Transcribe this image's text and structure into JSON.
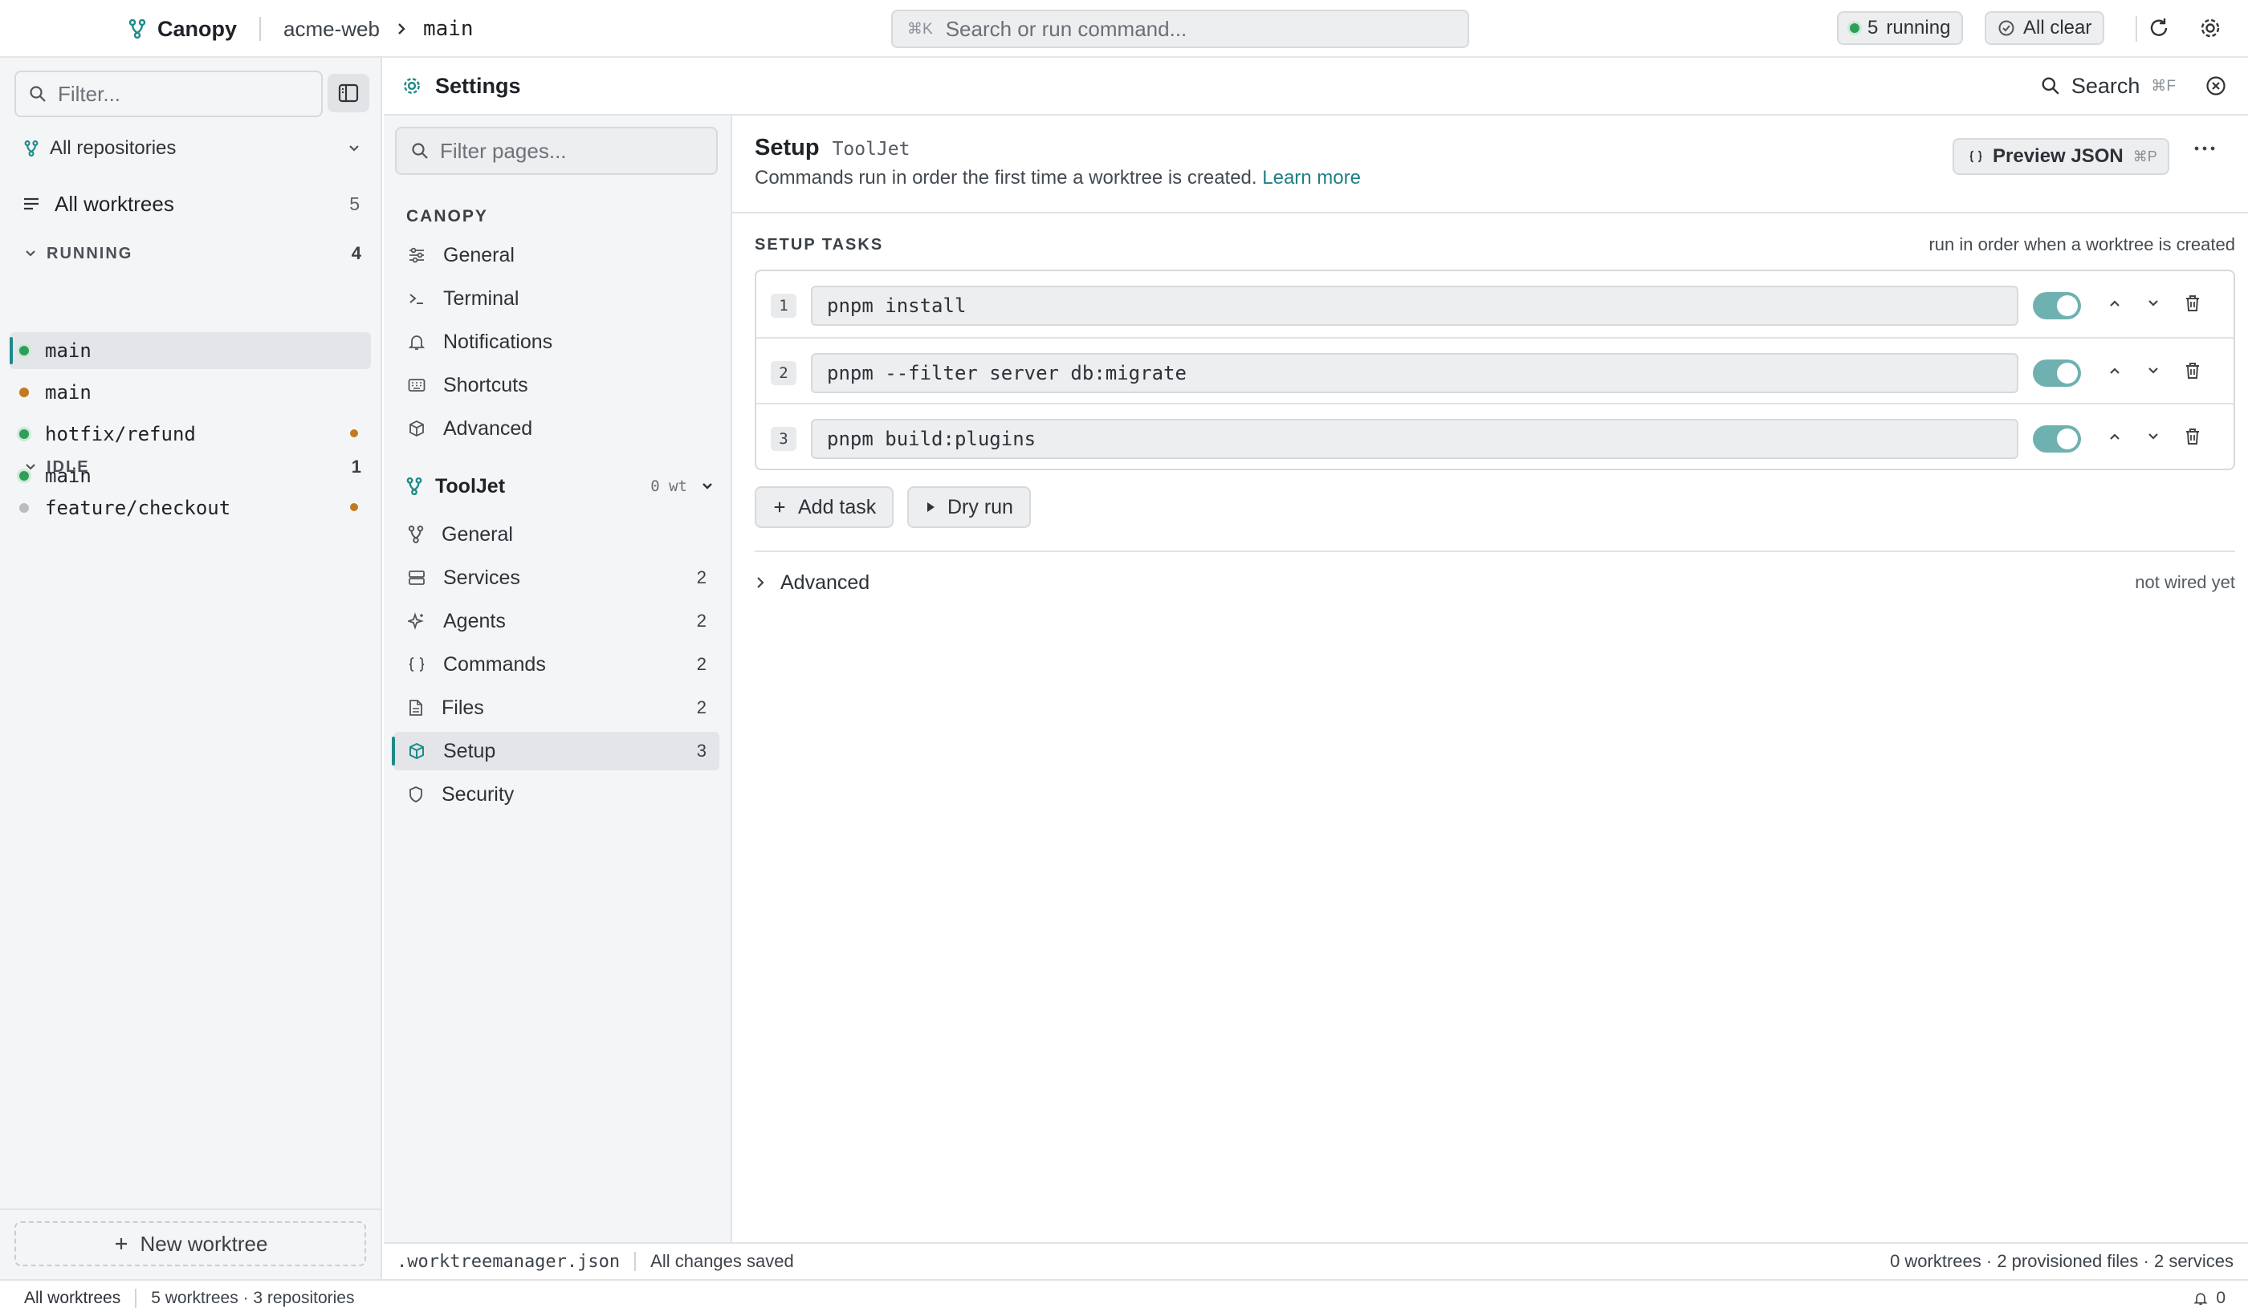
{
  "topbar": {
    "app_name": "Canopy",
    "repo": "acme-web",
    "branch": "main",
    "search_kbd": "⌘K",
    "search_placeholder": "Search or run command...",
    "running_count": "5",
    "running_label": "running",
    "clear_label": "All clear"
  },
  "sidebar": {
    "filter_placeholder": "Filter...",
    "repo_select": "All repositories",
    "all_worktrees_label": "All worktrees",
    "all_worktrees_count": "5",
    "groups": [
      {
        "label": "RUNNING",
        "count": "4",
        "items": [
          {
            "name": "main",
            "status": "green",
            "active": true
          },
          {
            "name": "main",
            "status": "orange"
          },
          {
            "name": "hotfix/refund",
            "status": "green",
            "flag": "orange"
          },
          {
            "name": "main",
            "status": "green"
          }
        ]
      },
      {
        "label": "IDLE",
        "count": "1",
        "items": [
          {
            "name": "feature/checkout",
            "status": "gray",
            "flag": "orange"
          }
        ]
      }
    ],
    "new_worktree_label": "New worktree"
  },
  "status_bar": {
    "scope": "All worktrees",
    "summary": "5 worktrees · 3 repositories",
    "notifications": "0"
  },
  "settings": {
    "title": "Settings",
    "search_label": "Search",
    "search_kbd": "⌘F",
    "nav": {
      "filter_placeholder": "Filter pages...",
      "app_section": "CANOPY",
      "app_items": [
        {
          "label": "General",
          "icon": "sliders-icon"
        },
        {
          "label": "Terminal",
          "icon": "terminal-icon"
        },
        {
          "label": "Notifications",
          "icon": "bell-icon"
        },
        {
          "label": "Shortcuts",
          "icon": "keyboard-icon"
        },
        {
          "label": "Advanced",
          "icon": "cube-icon"
        }
      ],
      "repo_name": "ToolJet",
      "repo_wt": "0 wt",
      "repo_items": [
        {
          "label": "General",
          "icon": "git-branch-icon",
          "count": ""
        },
        {
          "label": "Services",
          "icon": "server-icon",
          "count": "2"
        },
        {
          "label": "Agents",
          "icon": "sparkle-icon",
          "count": "2"
        },
        {
          "label": "Commands",
          "icon": "braces-icon",
          "count": "2"
        },
        {
          "label": "Files",
          "icon": "file-icon",
          "count": "2"
        },
        {
          "label": "Setup",
          "icon": "package-icon",
          "count": "3",
          "active": true
        },
        {
          "label": "Security",
          "icon": "shield-icon",
          "count": ""
        }
      ]
    },
    "page": {
      "title": "Setup",
      "repo": "ToolJet",
      "description": "Commands run in order the first time a worktree is created.",
      "learn_more": "Learn more",
      "preview_label": "Preview JSON",
      "preview_kbd": "⌘P",
      "tasks_heading": "SETUP TASKS",
      "tasks_note": "run in order when a worktree is created",
      "tasks": [
        {
          "num": "1",
          "command": "pnpm install",
          "enabled": true
        },
        {
          "num": "2",
          "command": "pnpm --filter server db:migrate",
          "enabled": true
        },
        {
          "num": "3",
          "command": "pnpm build:plugins",
          "enabled": true
        }
      ],
      "add_task_label": "Add task",
      "dry_run_label": "Dry run",
      "advanced_label": "Advanced",
      "advanced_note": "not wired yet"
    },
    "footer": {
      "file": ".worktreemanager.json",
      "save_state": "All changes saved",
      "summary": "0 worktrees · 2 provisioned files · 2 services"
    }
  },
  "colors": {
    "accent": "#1e8a8a",
    "running": "#2f9e5b",
    "warning": "#c27a1f",
    "idle": "#b9bdc2"
  }
}
